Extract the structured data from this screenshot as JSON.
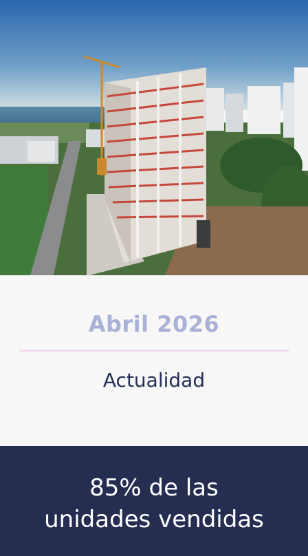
{
  "photo": {
    "alt": "",
    "colors": {
      "sky_top": "#2f6fb5",
      "sky_bottom": "#c9d9e2",
      "sea": "#4d7e9b",
      "grass": "#3f7b3a",
      "concrete": "#d8d6d2",
      "scaffold_red": "#c5473a"
    }
  },
  "info": {
    "date": "Abril 2026",
    "subtitle": "Actualidad"
  },
  "footer": {
    "line1": "85% de las",
    "line2": "unidades vendidas"
  },
  "colors": {
    "date_text": "#aab1d6",
    "divider": "#f3d9ee",
    "subtitle_text": "#242f55",
    "footer_bg": "#252e51",
    "footer_text": "#ffffff"
  }
}
